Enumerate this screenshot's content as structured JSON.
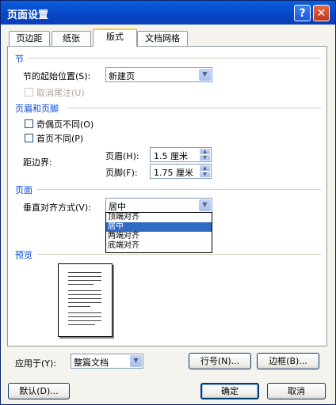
{
  "window": {
    "title": "页面设置",
    "help_label": "?",
    "close_label": "✕"
  },
  "tabs": [
    {
      "label": "页边距"
    },
    {
      "label": "纸张"
    },
    {
      "label": "版式",
      "active": true
    },
    {
      "label": "文档网格"
    }
  ],
  "section": {
    "title": "节",
    "start_label": "节的起始位置(S):",
    "start_value": "新建页",
    "suppress_endnotes_label": "取消尾注(U)"
  },
  "headers_footers": {
    "title": "页眉和页脚",
    "odd_even_label": "奇偶页不同(O)",
    "first_page_label": "首页不同(P)",
    "from_edge_label": "距边界:",
    "header_label": "页眉(H):",
    "header_value": "1.5 厘米",
    "footer_label": "页脚(F):",
    "footer_value": "1.75 厘米"
  },
  "page": {
    "title": "页面",
    "valign_label": "垂直对齐方式(V):",
    "valign_value": "居中",
    "valign_options": [
      "顶端对齐",
      "居中",
      "两端对齐",
      "底端对齐"
    ],
    "valign_selected_index": 1
  },
  "preview": {
    "title": "预览"
  },
  "bottom": {
    "apply_label": "应用于(Y):",
    "apply_value": "整篇文档",
    "line_numbers_button": "行号(N)...",
    "borders_button": "边框(B)..."
  },
  "footer": {
    "default_button": "默认(D)...",
    "ok_button": "确定",
    "cancel_button": "取消"
  },
  "colors": {
    "title_bar": "#0a5fde",
    "section_text": "#0046d5",
    "selection": "#316ac5"
  },
  "icons": {
    "dropdown": "chevron-down-icon",
    "spin": "spin-arrows-icon"
  }
}
